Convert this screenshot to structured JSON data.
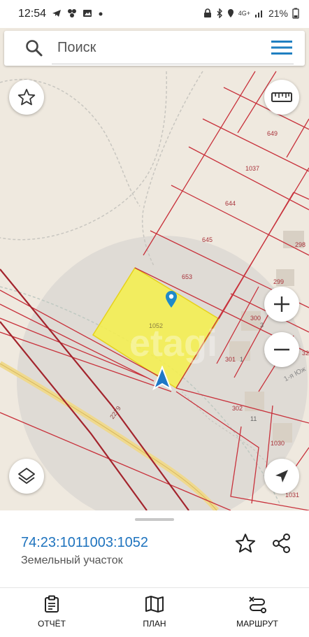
{
  "status_bar": {
    "time": "12:54",
    "network": "4G+",
    "battery": "21%"
  },
  "search": {
    "placeholder": "Поиск"
  },
  "map": {
    "parcel_labels": [
      "649",
      "1037",
      "644",
      "645",
      "653",
      "298",
      "299",
      "300",
      "3",
      "301",
      "1",
      "302",
      "11",
      "1030",
      "1031",
      "1052",
      "32"
    ],
    "street_label": "1-я Юж",
    "road_label": "2279",
    "watermark": "etagi",
    "highlight_color": "#f6f04a",
    "border_color": "#c8323c",
    "marker_color": "#1f8ac9"
  },
  "parcel_card": {
    "cadastral_number": "74:23:1011003:1052",
    "type": "Земельный участок"
  },
  "bottom_nav": {
    "items": [
      {
        "label": "ОТЧЁТ",
        "icon": "report-icon"
      },
      {
        "label": "ПЛАН",
        "icon": "map-icon"
      },
      {
        "label": "МАРШРУТ",
        "icon": "route-icon"
      }
    ]
  }
}
